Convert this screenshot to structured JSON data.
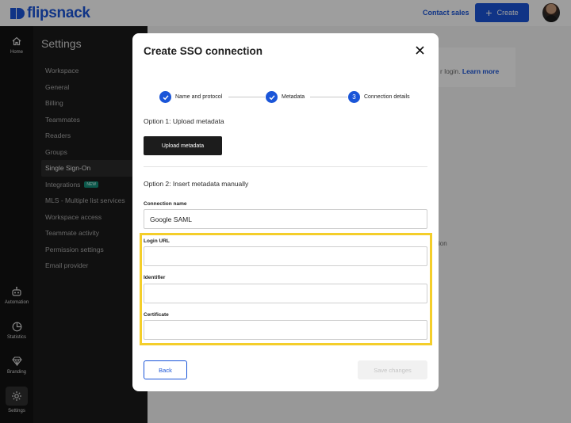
{
  "topbar": {
    "logo_text": "flipsnack",
    "contact_label": "Contact sales",
    "create_label": "Create",
    "colors": {
      "brand": "#1a55d8"
    }
  },
  "rail": {
    "items": [
      {
        "label": "Home",
        "icon": "home-icon"
      },
      {
        "label": "Automation",
        "icon": "robot-icon"
      },
      {
        "label": "Statistics",
        "icon": "pie-chart-icon"
      },
      {
        "label": "Branding",
        "icon": "diamond-icon"
      },
      {
        "label": "Settings",
        "icon": "gear-icon",
        "active": true
      }
    ]
  },
  "settings": {
    "title": "Settings",
    "items": [
      {
        "label": "Workspace"
      },
      {
        "label": "General"
      },
      {
        "label": "Billing"
      },
      {
        "label": "Teammates"
      },
      {
        "label": "Readers"
      },
      {
        "label": "Groups"
      },
      {
        "label": "Single Sign-On",
        "active": true
      },
      {
        "label": "Integrations",
        "badge": "NEW"
      },
      {
        "label": "MLS - Multiple list services"
      },
      {
        "label": "Workspace access"
      },
      {
        "label": "Teammate activity"
      },
      {
        "label": "Permission settings"
      },
      {
        "label": "Email provider"
      }
    ]
  },
  "background": {
    "text_fragment": "r login.",
    "learn_more": "Learn more",
    "text_fragment2": "ion"
  },
  "modal": {
    "title": "Create SSO connection",
    "steps": [
      {
        "label": "Name and protocol",
        "state": "done"
      },
      {
        "label": "Metadata",
        "state": "done"
      },
      {
        "label": "Connection details",
        "number": "3",
        "state": "current"
      }
    ],
    "option1_label": "Option 1: Upload metadata",
    "upload_label": "Upload metadata",
    "option2_label": "Option 2: Insert metadata manually",
    "fields": {
      "connection_name": {
        "label": "Connection name",
        "value": "Google SAML"
      },
      "login_url": {
        "label": "Login URL",
        "value": ""
      },
      "identifier": {
        "label": "Identifier",
        "value": ""
      },
      "certificate": {
        "label": "Certificate",
        "value": ""
      }
    },
    "back_label": "Back",
    "save_label": "Save changes",
    "highlight_color": "#f4ce2a"
  }
}
